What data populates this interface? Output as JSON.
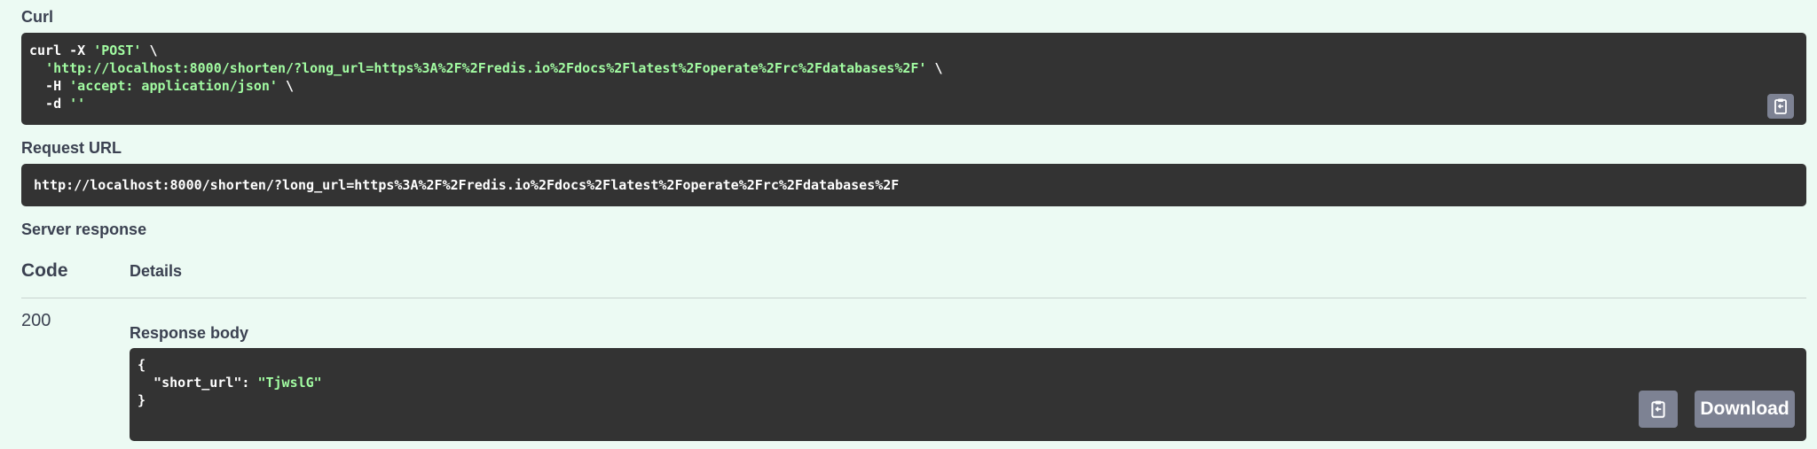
{
  "curl": {
    "label": "Curl",
    "lines": [
      {
        "pre": "curl -X ",
        "str": "'POST'",
        "post": " \\"
      },
      {
        "pre": "  ",
        "str": "'http://localhost:8000/shorten/?long_url=https%3A%2F%2Fredis.io%2Fdocs%2Flatest%2Foperate%2Frc%2Fdatabases%2F'",
        "post": " \\"
      },
      {
        "pre": "  -H ",
        "str": "'accept: application/json'",
        "post": " \\"
      },
      {
        "pre": "  -d ",
        "str": "''",
        "post": ""
      }
    ],
    "copy_icon": "clipboard-icon"
  },
  "request_url": {
    "label": "Request URL",
    "value": "http://localhost:8000/shorten/?long_url=https%3A%2F%2Fredis.io%2Fdocs%2Flatest%2Foperate%2Frc%2Fdatabases%2F"
  },
  "server_response": {
    "label": "Server response",
    "code_header": "Code",
    "details_header": "Details",
    "code": "200",
    "response_body_label": "Response body",
    "body": {
      "open": "{",
      "key": "  \"short_url\": ",
      "value": "\"TjwslG\"",
      "close": "}"
    },
    "copy_icon": "clipboard-icon",
    "download_label": "Download"
  },
  "colors": {
    "background": "#ecfaf3",
    "code_bg": "#333333",
    "string": "#a2fca2",
    "button": "#7d8293"
  }
}
